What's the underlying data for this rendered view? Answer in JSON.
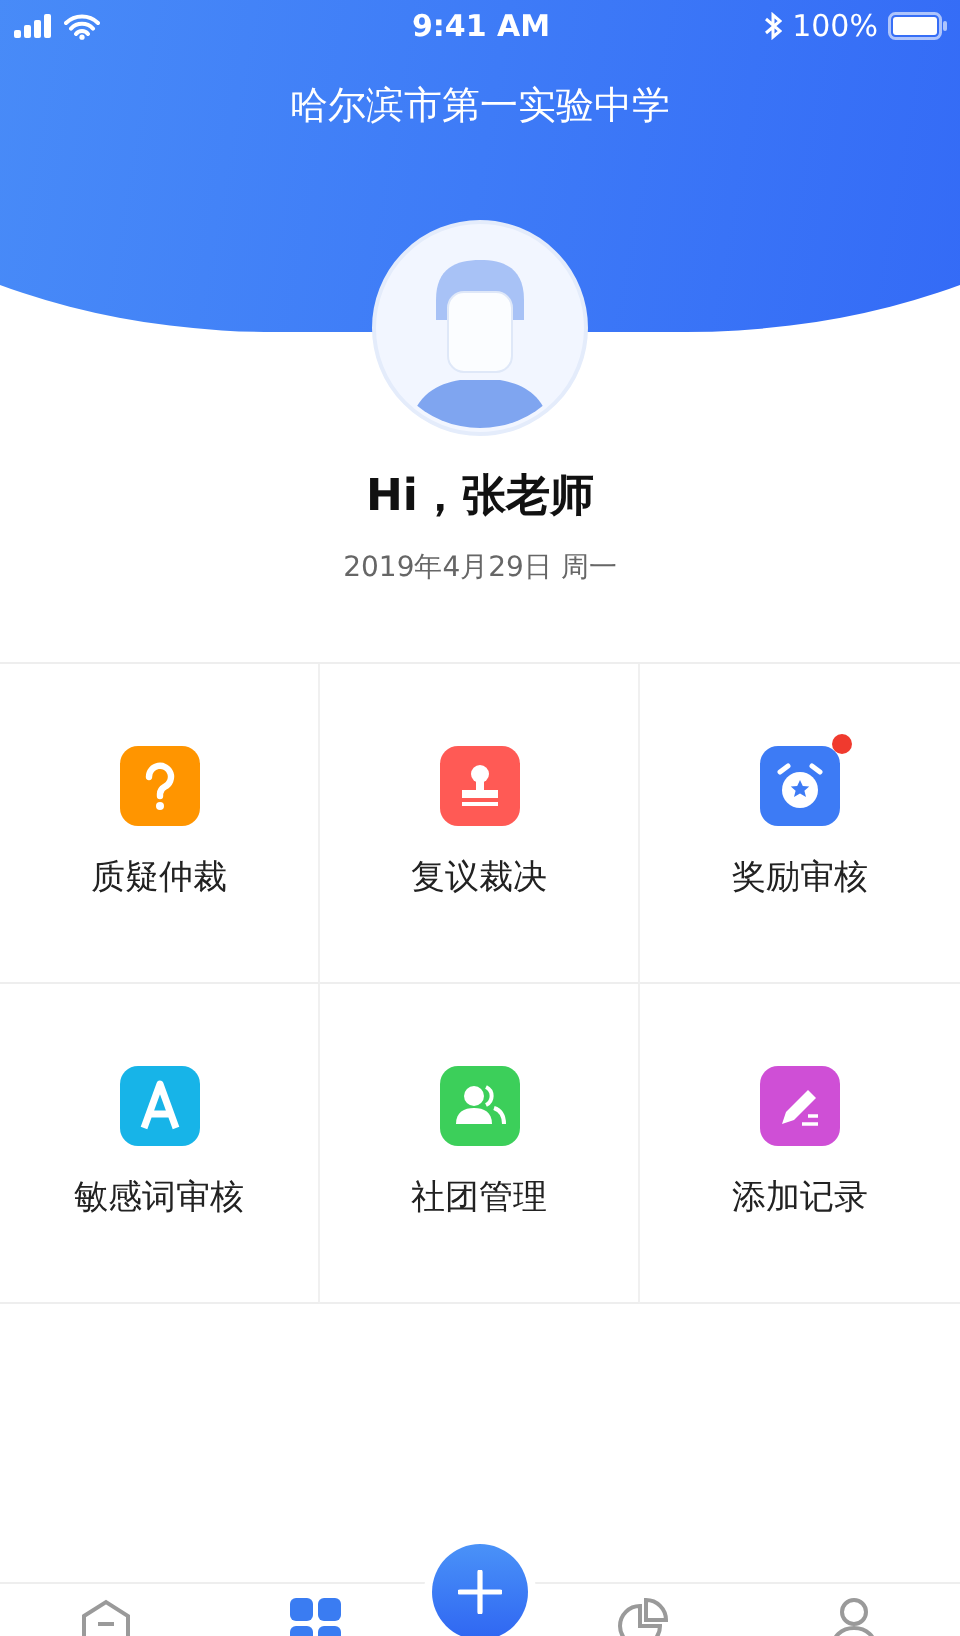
{
  "status_bar": {
    "time": "9:41 AM",
    "battery": "100%"
  },
  "header": {
    "title": "哈尔滨市第一实验中学"
  },
  "greeting": "Hi，张老师",
  "date": "2019年4月29日 周一",
  "features": [
    {
      "label": "质疑仲裁",
      "kind": "question",
      "color": "#ff9500",
      "badge": false
    },
    {
      "label": "复议裁决",
      "kind": "stamp",
      "color": "#ff5a55",
      "badge": false
    },
    {
      "label": "奖励审核",
      "kind": "clock",
      "color": "#3d7bf5",
      "badge": true
    },
    {
      "label": "敏感词审核",
      "kind": "letter",
      "color": "#17b4e8",
      "badge": false
    },
    {
      "label": "社团管理",
      "kind": "people",
      "color": "#3ccf5a",
      "badge": false
    },
    {
      "label": "添加记录",
      "kind": "pen",
      "color": "#cf4fd6",
      "badge": false
    }
  ],
  "tab_bar": [
    {
      "kind": "home",
      "selected": false
    },
    {
      "kind": "grid",
      "selected": true
    },
    {
      "kind": "add",
      "selected": false
    },
    {
      "kind": "chart",
      "selected": false
    },
    {
      "kind": "user",
      "selected": false
    }
  ]
}
